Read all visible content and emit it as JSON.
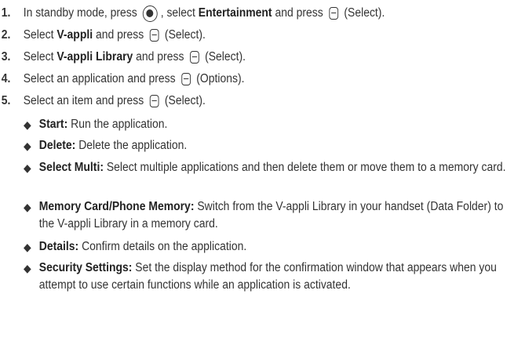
{
  "steps": [
    {
      "num": "1.",
      "pre": "In standby mode, press",
      "mid": ", select",
      "bold": "Entertainment",
      "post": "and press",
      "tail": "(Select)."
    },
    {
      "num": "2.",
      "pre": "Select",
      "bold": "V-appli",
      "post": "and press",
      "tail": "(Select)."
    },
    {
      "num": "3.",
      "pre": "Select",
      "bold": "V-appli Library",
      "post": "and press",
      "tail": "(Select)."
    },
    {
      "num": "4.",
      "pre": "Select an application and press",
      "tail": "(Options)."
    },
    {
      "num": "5.",
      "pre": "Select an item and press",
      "tail": "(Select)."
    }
  ],
  "options": [
    {
      "label": "Start:",
      "text": "Run the application."
    },
    {
      "label": "Delete:",
      "text": "Delete the application."
    },
    {
      "label": "Select Multi:",
      "text": "Select multiple applications and then delete them or move them to a memory card."
    },
    {
      "label": "Memory Card/Phone Memory:",
      "text": "Switch from the V-appli Library in your handset (Data Folder) to the V-appli Library in a memory card."
    },
    {
      "label": "Details:",
      "text": "Confirm details on the application."
    },
    {
      "label": "Security Settings:",
      "text": "Set the display method for the confirmation window that appears when you attempt to use certain functions while an application is activated."
    }
  ]
}
